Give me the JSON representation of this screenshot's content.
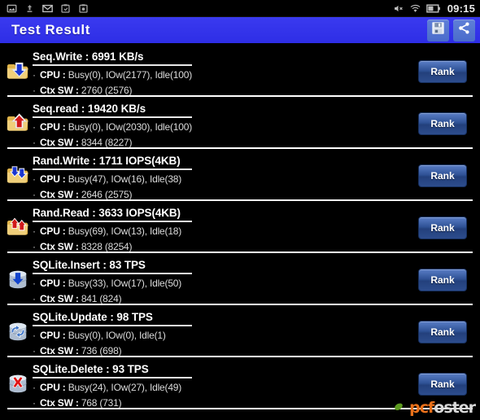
{
  "statusbar": {
    "time": "09:15",
    "left_icons": [
      {
        "name": "gallery-icon"
      },
      {
        "name": "upload-icon"
      },
      {
        "name": "gmail-icon"
      },
      {
        "name": "sync-app-icon"
      },
      {
        "name": "camera-app-icon"
      }
    ],
    "right_icons": [
      {
        "name": "volume-mute-icon"
      },
      {
        "name": "wifi-icon"
      },
      {
        "name": "battery-icon"
      }
    ]
  },
  "titlebar": {
    "title": "Test Result",
    "save_icon": "save-icon",
    "share_icon": "share-icon",
    "accent_color": "#3333ee"
  },
  "results": [
    {
      "icon": "folder-write-blue-icon",
      "title": "Seq.Write : 6991 KB/s",
      "cpu_label": "CPU :",
      "cpu_value": "Busy(0), IOw(2177), Idle(100)",
      "ctx_label": "Ctx SW :",
      "ctx_value": "2760 (2576)",
      "rank_label": "Rank"
    },
    {
      "icon": "folder-read-red-icon",
      "title": "Seq.read : 19420 KB/s",
      "cpu_label": "CPU :",
      "cpu_value": "Busy(0), IOw(2030), Idle(100)",
      "ctx_label": "Ctx SW :",
      "ctx_value": "8344 (8227)",
      "rank_label": "Rank"
    },
    {
      "icon": "folder-random-write-blue-icon",
      "title": "Rand.Write : 1711 IOPS(4KB)",
      "cpu_label": "CPU :",
      "cpu_value": "Busy(47), IOw(16), Idle(38)",
      "ctx_label": "Ctx SW :",
      "ctx_value": "2646 (2575)",
      "rank_label": "Rank"
    },
    {
      "icon": "folder-random-read-red-icon",
      "title": "Rand.Read : 3633 IOPS(4KB)",
      "cpu_label": "CPU :",
      "cpu_value": "Busy(69), IOw(13), Idle(18)",
      "ctx_label": "Ctx SW :",
      "ctx_value": "8328 (8254)",
      "rank_label": "Rank"
    },
    {
      "icon": "database-insert-icon",
      "title": "SQLite.Insert : 83 TPS",
      "cpu_label": "CPU :",
      "cpu_value": "Busy(33), IOw(17), Idle(50)",
      "ctx_label": "Ctx SW :",
      "ctx_value": "841 (824)",
      "rank_label": "Rank"
    },
    {
      "icon": "database-update-icon",
      "title": "SQLite.Update : 98 TPS",
      "cpu_label": "CPU :",
      "cpu_value": "Busy(0), IOw(0), Idle(1)",
      "ctx_label": "Ctx SW :",
      "ctx_value": "736 (698)",
      "rank_label": "Rank"
    },
    {
      "icon": "database-delete-icon",
      "title": "SQLite.Delete : 93 TPS",
      "cpu_label": "CPU :",
      "cpu_value": "Busy(24), IOw(27), Idle(49)",
      "ctx_label": "Ctx SW :",
      "ctx_value": "768 (731)",
      "rank_label": "Rank"
    }
  ],
  "watermark": {
    "text_a": "pcf",
    "text_b": "oster",
    "color_a": "#e8701a",
    "color_b": "#d8d8d8"
  }
}
